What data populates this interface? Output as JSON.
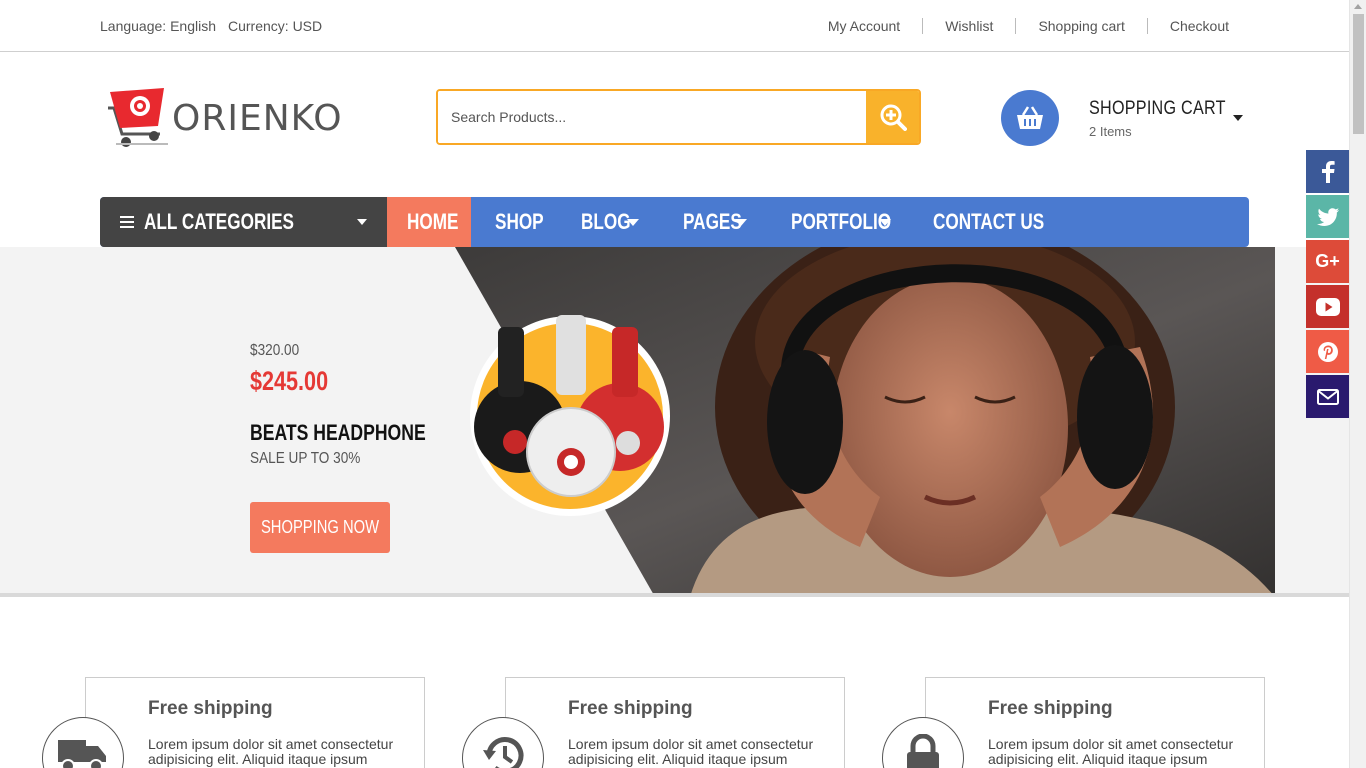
{
  "topbar": {
    "language": "Language: English",
    "currency": "Currency: USD",
    "links": [
      "My Account",
      "Wishlist",
      "Shopping cart",
      "Checkout"
    ]
  },
  "header": {
    "logo_text": "ORIENKO",
    "search_placeholder": "Search Products...",
    "cart_title": "SHOPPING CART",
    "cart_count": "2 Items"
  },
  "nav": {
    "all_categories": "ALL CATEGORIES",
    "items": [
      "HOME",
      "SHOP",
      "BLOG",
      "PAGES",
      "PORTFOLIO",
      "CONTACT US"
    ],
    "active": "HOME"
  },
  "hero": {
    "old_price": "$320.00",
    "new_price": "$245.00",
    "product_name": "BEATS HEADPHONE",
    "sale_text": "SALE UP TO 30%",
    "button": "SHOPPING NOW"
  },
  "social": [
    "facebook-icon",
    "twitter-icon",
    "google-plus-icon",
    "youtube-icon",
    "pinterest-icon",
    "mail-icon"
  ],
  "features": [
    {
      "title": "Free shipping",
      "text": "Lorem ipsum dolor sit amet consectetur adipisicing elit. Aliquid itaque ipsum",
      "icon": "truck-icon"
    },
    {
      "title": "Free shipping",
      "text": "Lorem ipsum dolor sit amet consectetur adipisicing elit. Aliquid itaque ipsum",
      "icon": "history-icon"
    },
    {
      "title": "Free shipping",
      "text": "Lorem ipsum dolor sit amet consectetur adipisicing elit. Aliquid itaque ipsum",
      "icon": "lock-icon"
    }
  ],
  "colors": {
    "accent_blue": "#4a7ad0",
    "accent_orange": "#f9b22b",
    "accent_coral": "#f47a5e",
    "price_red": "#e53935",
    "dark_menu": "#444444"
  }
}
